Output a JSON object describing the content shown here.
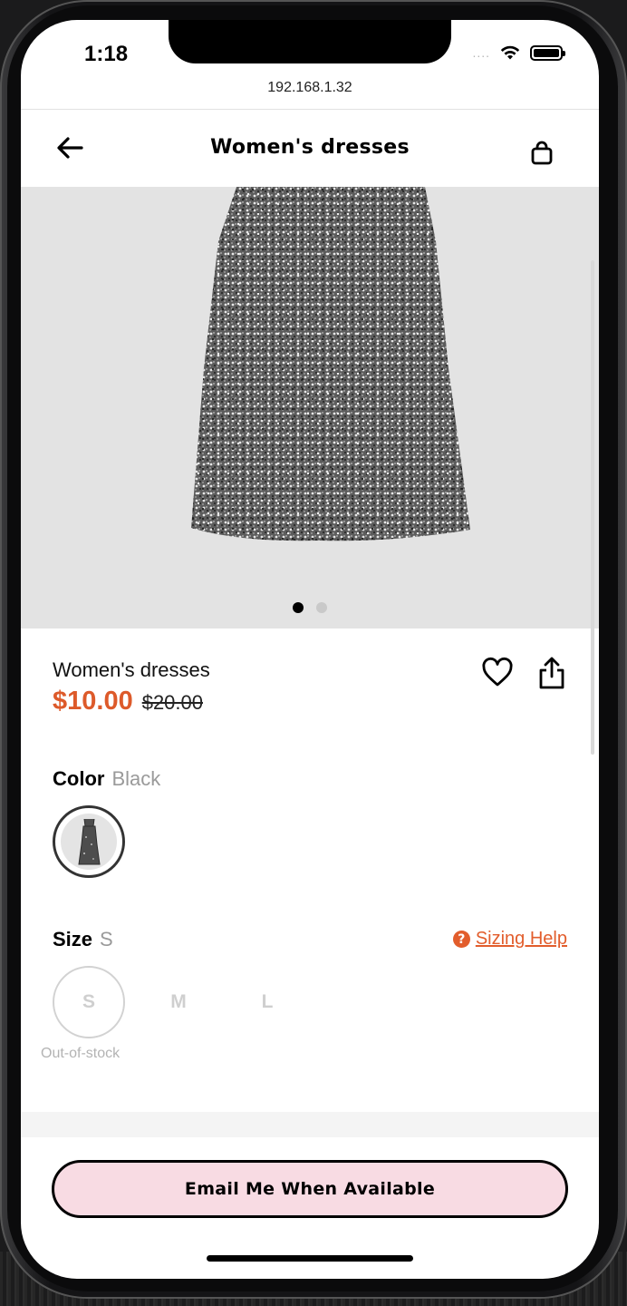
{
  "status_bar": {
    "time": "1:18",
    "signal": "....",
    "url": "192.168.1.32"
  },
  "header": {
    "title": "Women's dresses",
    "back_icon": "arrow-left-icon",
    "bag_icon": "shopping-bag-icon"
  },
  "gallery": {
    "image": "sequin-dress",
    "pages": 2,
    "active_page": 1
  },
  "product": {
    "name": "Women's dresses",
    "sale_price": "$10.00",
    "original_price": "$20.00",
    "favorite_icon": "heart-icon",
    "share_icon": "share-icon"
  },
  "color": {
    "label": "Color",
    "selected": "Black"
  },
  "size": {
    "label": "Size",
    "selected": "S",
    "help_label": "Sizing Help",
    "help_icon": "question-circle-icon",
    "options": [
      "S",
      "M",
      "L"
    ],
    "stock_note": "Out-of-stock"
  },
  "cta": {
    "label": "Email Me When Available"
  },
  "colors": {
    "accent": "#dd5a2a",
    "cta_background": "#f8dbe3",
    "gallery_background": "#e3e3e3"
  }
}
